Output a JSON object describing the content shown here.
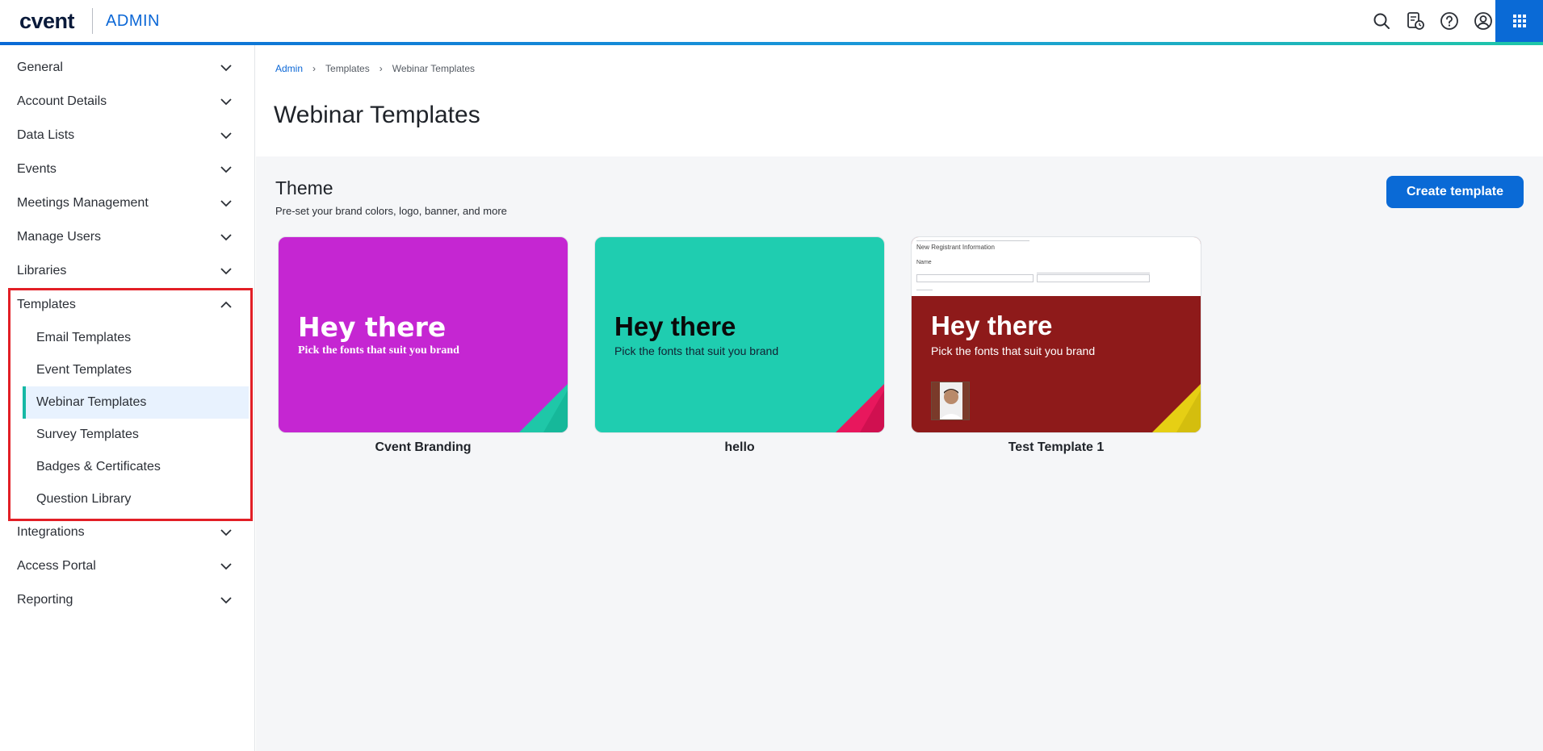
{
  "header": {
    "logo": "cvent",
    "section": "ADMIN",
    "icons": [
      "search-icon",
      "event-schedule-icon",
      "help-icon",
      "account-icon",
      "apps-grid-icon"
    ]
  },
  "sidebar": {
    "items": [
      {
        "label": "General"
      },
      {
        "label": "Account Details"
      },
      {
        "label": "Data Lists"
      },
      {
        "label": "Events"
      },
      {
        "label": "Meetings Management"
      },
      {
        "label": "Manage Users"
      },
      {
        "label": "Libraries"
      },
      {
        "label": "Templates"
      },
      {
        "label": "Integrations"
      },
      {
        "label": "Access Portal"
      },
      {
        "label": "Reporting"
      }
    ],
    "templates_sub": [
      {
        "label": "Email Templates"
      },
      {
        "label": "Event Templates"
      },
      {
        "label": "Webinar Templates"
      },
      {
        "label": "Survey Templates"
      },
      {
        "label": "Badges & Certificates"
      },
      {
        "label": "Question Library"
      }
    ]
  },
  "breadcrumb": {
    "admin": "Admin",
    "templates": "Templates",
    "current": "Webinar Templates"
  },
  "page": {
    "title": "Webinar Templates"
  },
  "theme": {
    "title": "Theme",
    "subtitle": "Pre-set your brand colors, logo, banner, and more",
    "create_button": "Create template"
  },
  "cards": [
    {
      "name": "Cvent Branding",
      "heading": "Hey there",
      "sub": "Pick the fonts that suit you brand",
      "bg": "#c526d2",
      "corner": "#1fc7a8"
    },
    {
      "name": "hello",
      "heading": "Hey there",
      "sub": "Pick the fonts that suit you brand",
      "bg": "#1fcdb0",
      "corner": "#e8175d"
    },
    {
      "name": "Test Template 1",
      "heading": "Hey there",
      "sub": "Pick the fonts that suit you brand",
      "bg": "#8e1a1a",
      "corner": "#e6cf14",
      "preview": {
        "heading": "New Registrant Information",
        "field1": "Name"
      }
    }
  ],
  "colors": {
    "accent": "#0a6ad6",
    "active_indicator": "#16b8a5",
    "highlight": "#e21f26"
  }
}
